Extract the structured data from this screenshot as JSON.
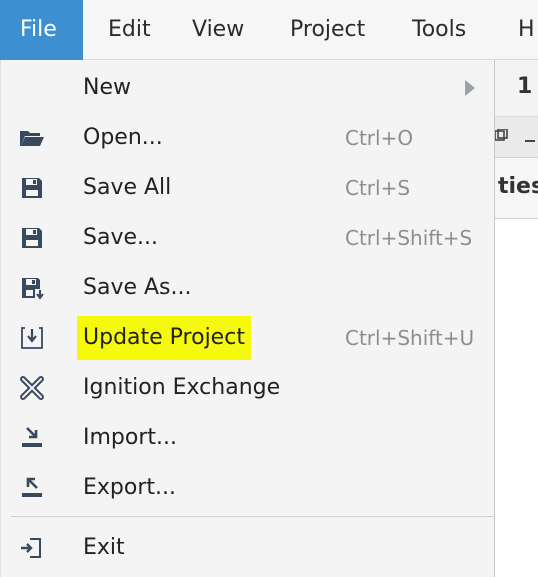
{
  "menubar": {
    "items": [
      {
        "label": "File",
        "active": true
      },
      {
        "label": "Edit"
      },
      {
        "label": "View"
      },
      {
        "label": "Project"
      },
      {
        "label": "Tools"
      },
      {
        "label": "H"
      }
    ]
  },
  "background": {
    "fragments": [
      "1",
      "ties"
    ]
  },
  "file_menu": {
    "items": [
      {
        "label": "New",
        "shortcut": "",
        "icon": "none",
        "submenu": true
      },
      {
        "label": "Open...",
        "shortcut": "Ctrl+O",
        "icon": "folder-open-icon"
      },
      {
        "label": "Save All",
        "shortcut": "Ctrl+S",
        "icon": "save-all-icon"
      },
      {
        "label": "Save...",
        "shortcut": "Ctrl+Shift+S",
        "icon": "save-icon"
      },
      {
        "label": "Save As...",
        "shortcut": "",
        "icon": "save-as-icon"
      },
      {
        "label": "Update Project",
        "shortcut": "Ctrl+Shift+U",
        "icon": "update-project-icon",
        "highlighted": true
      },
      {
        "label": "Ignition Exchange",
        "shortcut": "",
        "icon": "exchange-icon"
      },
      {
        "label": "Import...",
        "shortcut": "",
        "icon": "import-icon"
      },
      {
        "label": "Export...",
        "shortcut": "",
        "icon": "export-icon"
      },
      {
        "label": "Exit",
        "shortcut": "",
        "icon": "exit-icon"
      }
    ]
  },
  "colors": {
    "active_menu_bg": "#3c8fd0",
    "highlight": "#f5f90c",
    "icon": "#3a4a5e"
  }
}
